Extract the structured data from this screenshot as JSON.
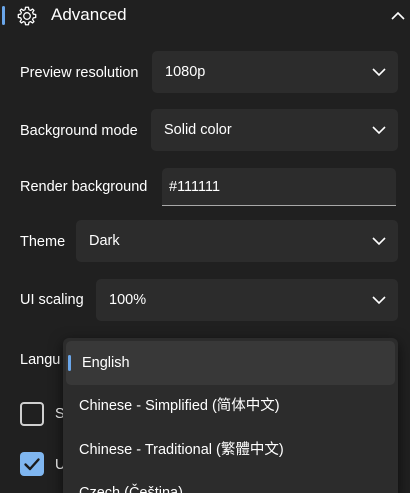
{
  "section": {
    "title": "Advanced"
  },
  "settings": {
    "preview_resolution": {
      "label": "Preview resolution",
      "value": "1080p"
    },
    "background_mode": {
      "label": "Background mode",
      "value": "Solid color"
    },
    "render_background": {
      "label": "Render background",
      "value": "#111111"
    },
    "theme": {
      "label": "Theme",
      "value": "Dark"
    },
    "ui_scaling": {
      "label": "UI scaling",
      "value": "100%"
    },
    "language": {
      "label": "Langu"
    }
  },
  "checkboxes": [
    {
      "label_fragment": "S",
      "checked": false
    },
    {
      "label_fragment": "U",
      "checked": true
    }
  ],
  "language_dropdown": {
    "options": [
      {
        "label": "English",
        "selected": true
      },
      {
        "label": "Chinese - Simplified (简体中文)",
        "selected": false
      },
      {
        "label": "Chinese - Traditional (繁體中文)",
        "selected": false
      },
      {
        "label": "Czech (Čeština)",
        "selected": false
      }
    ]
  },
  "colors": {
    "background": "#202020",
    "control": "#2c2c2c",
    "accent": "#6aa6ea",
    "checkbox_checked": "#7fb6f0"
  },
  "icons": {
    "section": "gear-icon",
    "collapse": "chevron-up-icon",
    "select": "chevron-down-icon",
    "checked": "checkmark-icon"
  }
}
